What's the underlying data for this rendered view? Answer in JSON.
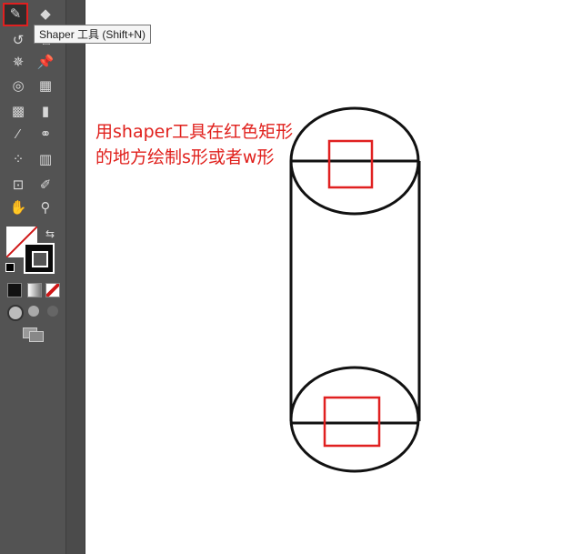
{
  "tooltip": "Shaper 工具 (Shift+N)",
  "annotation": {
    "line1": "用shaper工具在红色矩形",
    "line2": "的地方绘制s形或者w形"
  },
  "tools": [
    {
      "name": "shaper-tool",
      "glyph": "✎"
    },
    {
      "name": "eraser-tool",
      "glyph": "◆"
    },
    {
      "name": "rotate-tool",
      "glyph": "↺"
    },
    {
      "name": "free-transform-tool",
      "glyph": "⧉"
    },
    {
      "name": "puppet-warp-tool",
      "glyph": "✵"
    },
    {
      "name": "pin-tool",
      "glyph": "📌"
    },
    {
      "name": "shape-builder-tool",
      "glyph": "◎"
    },
    {
      "name": "perspective-grid-tool",
      "glyph": "▦"
    },
    {
      "name": "mesh-tool",
      "glyph": "▩"
    },
    {
      "name": "gradient-tool",
      "glyph": "▮"
    },
    {
      "name": "eyedropper-tool",
      "glyph": "⁄"
    },
    {
      "name": "blend-tool",
      "glyph": "⚭"
    },
    {
      "name": "symbol-sprayer-tool",
      "glyph": "⁘"
    },
    {
      "name": "column-graph-tool",
      "glyph": "▥"
    },
    {
      "name": "artboard-tool",
      "glyph": "⊡"
    },
    {
      "name": "slice-tool",
      "glyph": "✐"
    },
    {
      "name": "hand-tool",
      "glyph": "✋"
    },
    {
      "name": "zoom-tool",
      "glyph": "⚲"
    }
  ],
  "colors": {
    "accent": "#e02020",
    "toolbar": "#535353"
  }
}
